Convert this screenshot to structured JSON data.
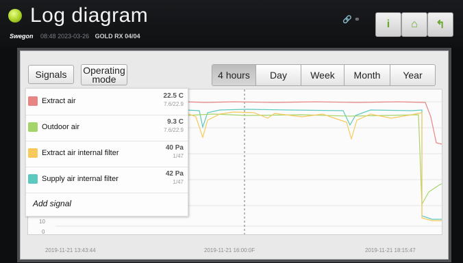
{
  "header": {
    "title": "Log diagram",
    "brand": "Swegon",
    "time": "08:48",
    "date": "2023-03-26",
    "model": "GOLD RX 04/04",
    "buttons": [
      {
        "name": "info-button",
        "glyph": "i"
      },
      {
        "name": "home-button",
        "glyph": "⌂"
      },
      {
        "name": "back-button",
        "glyph": "↰"
      }
    ]
  },
  "controls": {
    "signals_label": "Signals",
    "operating_mode_label": "Operating mode",
    "time_tabs": [
      {
        "label": "4 hours",
        "active": true
      },
      {
        "label": "Day",
        "active": false
      },
      {
        "label": "Week",
        "active": false
      },
      {
        "label": "Month",
        "active": false
      },
      {
        "label": "Year",
        "active": false
      }
    ]
  },
  "legend": {
    "items": [
      {
        "name": "Extract air",
        "value": "22.5 C",
        "range": "7.6/22.9",
        "color": "#e98484"
      },
      {
        "name": "Outdoor air",
        "value": "9.3 C",
        "range": "7.6/22.9",
        "color": "#a5d46a"
      },
      {
        "name": "Extract air internal filter",
        "value": "40 Pa",
        "range": "1/47",
        "color": "#f6c95a"
      },
      {
        "name": "Supply air internal filter",
        "value": "42 Pa",
        "range": "1/47",
        "color": "#5cc9c0"
      }
    ],
    "add_signal_label": "Add signal"
  },
  "chart": {
    "yticks": [
      "10",
      "0"
    ],
    "xlabels": [
      "2019-11-21 13:43:44",
      "2019-11-21 16:00:0F",
      "2019-11-21 18:15:47"
    ]
  }
}
